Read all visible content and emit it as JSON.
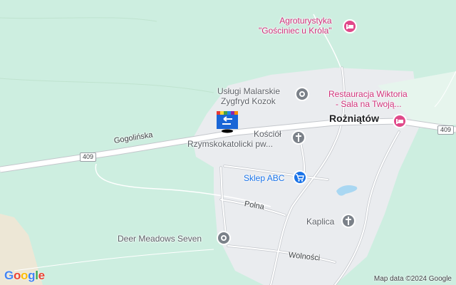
{
  "map": {
    "colors": {
      "land": "#cdeee0",
      "forest": "#c6ebd6",
      "town_area": "#eaecef",
      "road": "#ffffff",
      "road_edge": "#c4c7cc",
      "water": "#a9d7f2",
      "sand": "#ede7d6"
    },
    "town_name": "Rożniątów",
    "roads": {
      "main": "Gogolińska",
      "polna": "Polna",
      "wolnosci": "Wolności"
    },
    "shields": {
      "left": "409",
      "right": "409"
    },
    "pois": {
      "agroturystyka": {
        "line1": "Agroturystyka",
        "line2": "\"Gościniec u Króla\"",
        "icon": "bed-icon"
      },
      "uslugi": {
        "line1": "Usługi Malarskie",
        "line2": "Zygfryd Kozok",
        "icon": "circle-icon"
      },
      "restauracja": {
        "line1": "Restauracja Wiktoria",
        "line2": "- Sala na Twoją...",
        "icon": "bed-icon"
      },
      "kosciol": {
        "line1": "Kościół",
        "line2": "Rzymskokatolicki pw...",
        "icon": "cross-icon"
      },
      "sklep": {
        "label": "Sklep ABC",
        "icon": "cart-icon"
      },
      "kaplica": {
        "label": "Kaplica",
        "icon": "cross-icon"
      },
      "deer": {
        "label": "Deer Meadows Seven",
        "icon": "circle-icon"
      }
    },
    "attribution": "Map data ©2024 Google",
    "google_logo": "Google"
  }
}
